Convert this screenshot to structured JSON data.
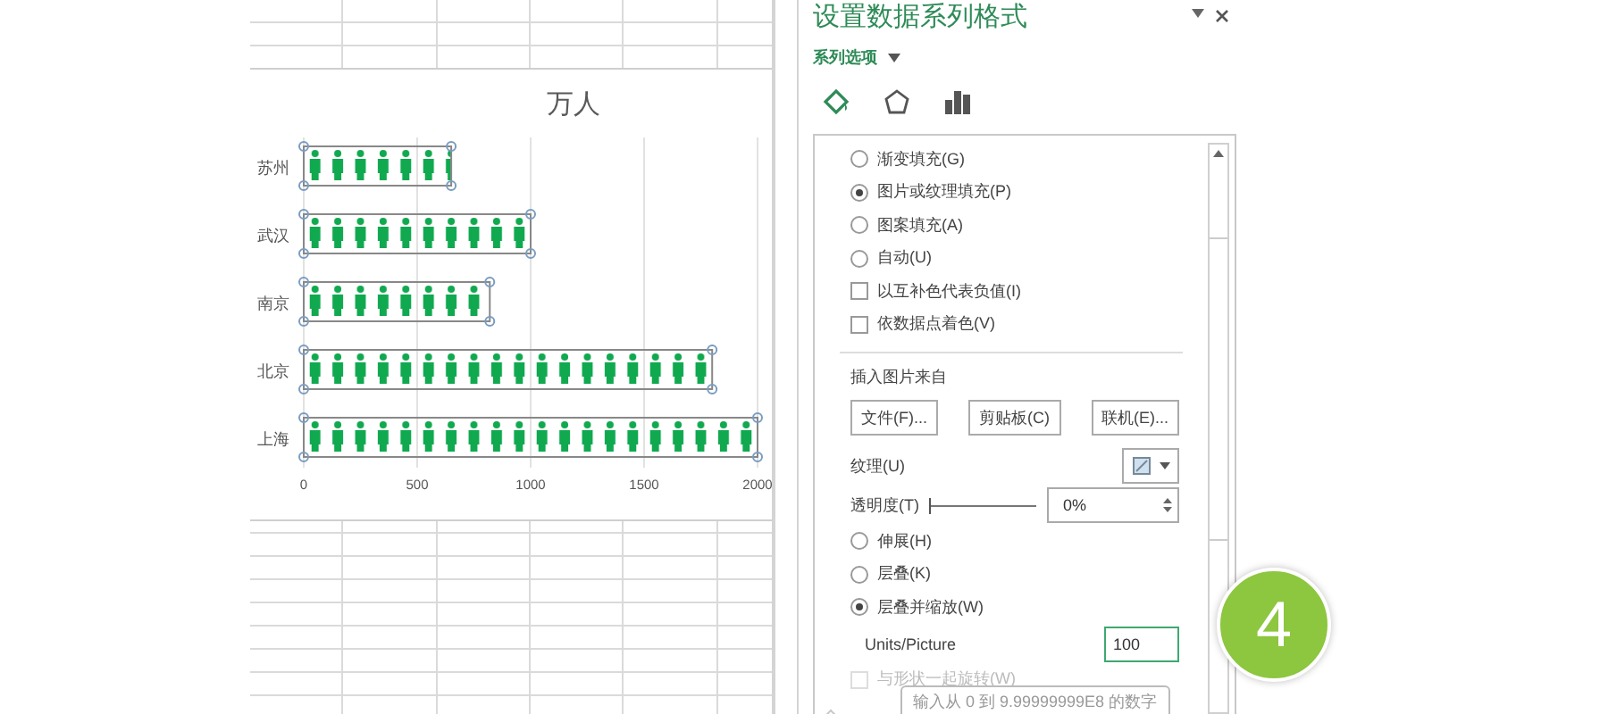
{
  "chart": {
    "selected": true,
    "chart_data": {
      "type": "bar",
      "orientation": "horizontal",
      "grid": true,
      "categories": [
        "苏州",
        "武汉",
        "南京",
        "北京",
        "上海"
      ],
      "series": [
        {
          "name": "万人",
          "values": [
            650,
            1000,
            820,
            1800,
            2000
          ]
        }
      ],
      "xlim": [
        0,
        2000
      ],
      "xticks": [
        0,
        500,
        1000,
        1500,
        2000
      ]
    }
  },
  "panel": {
    "title": "设置数据系列格式",
    "section": "系列选项",
    "tabs": [
      {
        "kind": "fill",
        "selected": true
      },
      {
        "kind": "effects",
        "selected": false
      },
      {
        "kind": "series",
        "selected": false
      }
    ],
    "fill_options": [
      {
        "kind": "radio",
        "label": "渐变填充(G)",
        "checked": false
      },
      {
        "kind": "radio",
        "label": "图片或纹理填充(P)",
        "checked": true
      },
      {
        "kind": "radio",
        "label": "图案填充(A)",
        "checked": false
      },
      {
        "kind": "radio",
        "label": "自动(U)",
        "checked": false
      },
      {
        "kind": "checkbox",
        "label": "以互补色代表负值(I)",
        "checked": false
      },
      {
        "kind": "checkbox",
        "label": "依数据点着色(V)",
        "checked": false
      }
    ],
    "insert_from": {
      "label": "插入图片来自",
      "buttons": [
        "文件(F)...",
        "剪贴板(C)",
        "联机(E)..."
      ]
    },
    "texture": {
      "label": "纹理(U)"
    },
    "transparency": {
      "label": "透明度(T)",
      "level": 0,
      "value": "0%"
    },
    "picture_modes": [
      {
        "label": "伸展(H)",
        "checked": false
      },
      {
        "label": "层叠(K)",
        "checked": false
      },
      {
        "label": "层叠并缩放(W)",
        "checked": true
      }
    ],
    "units": {
      "label": "Units/Picture",
      "value": "100"
    },
    "rotate": {
      "label": "与形状一起旋转(W)",
      "checked": false
    },
    "tooltip": "输入从 0 到 9.99999999E8 的数字"
  },
  "step_badge": "4"
}
